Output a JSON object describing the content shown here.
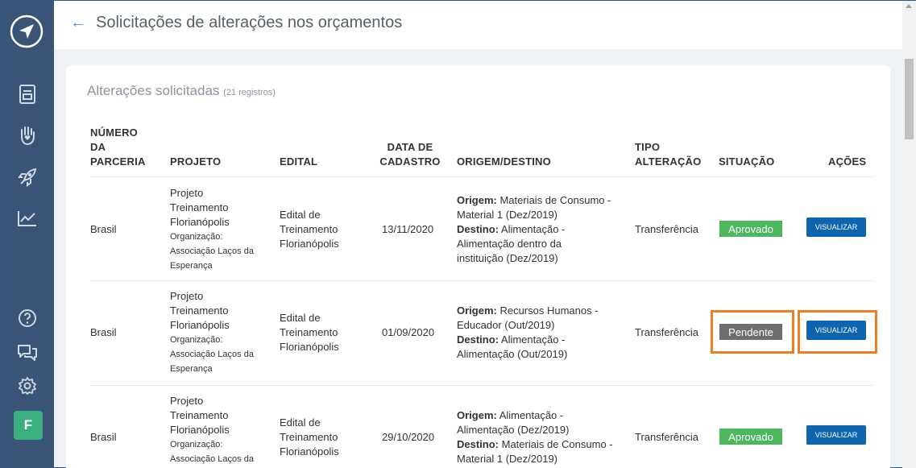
{
  "header": {
    "back_icon": "arrow-left-icon",
    "title": "Solicitações de alterações nos orçamentos"
  },
  "sidebar": {
    "logo_icon": "compass-logo-icon",
    "items": [
      "document-icon",
      "hand-heart-icon",
      "rocket-icon",
      "chart-icon"
    ],
    "bottom": [
      "help-icon",
      "chat-icon",
      "gear-icon"
    ],
    "avatar": "F"
  },
  "section": {
    "title": "Alterações solicitadas",
    "count": "(21 registros)"
  },
  "columns": {
    "numero_1": "NÚMERO",
    "numero_2": "DA",
    "numero_3": "PARCERIA",
    "projeto": "PROJETO",
    "edital": "EDITAL",
    "data_1": "DATA DE",
    "data_2": "CADASTRO",
    "origem": "ORIGEM/DESTINO",
    "tipo_1": "TIPO",
    "tipo_2": "ALTERAÇÃO",
    "situacao": "SITUAÇÃO",
    "acoes": "AÇÕES"
  },
  "rows": [
    {
      "parceria": "Brasil",
      "projeto_1": "Projeto",
      "projeto_2": "Treinamento",
      "projeto_3": "Florianópolis",
      "org_1": "Organização:",
      "org_2": "Associação Laços da",
      "org_3": "Esperança",
      "edital_1": "Edital de",
      "edital_2": "Treinamento",
      "edital_3": "Florianópolis",
      "data": "13/11/2020",
      "origem_label": "Origem:",
      "origem_1": " Materiais de Consumo -",
      "origem_2": "Material 1 (Dez/2019)",
      "destino_label": "Destino:",
      "destino_1": " Alimentação -",
      "destino_2": "Alimentação dentro da",
      "destino_3": "instituição (Dez/2019)",
      "tipo": "Transferência",
      "situacao": "Aprovado",
      "acao": "VISUALIZAR"
    },
    {
      "parceria": "Brasil",
      "projeto_1": "Projeto",
      "projeto_2": "Treinamento",
      "projeto_3": "Florianópolis",
      "org_1": "Organização:",
      "org_2": "Associação Laços da",
      "org_3": "Esperança",
      "edital_1": "Edital de",
      "edital_2": "Treinamento",
      "edital_3": "Florianópolis",
      "data": "01/09/2020",
      "origem_label": "Origem:",
      "origem_1": " Recursos Humanos -",
      "origem_2": "Educador (Out/2019)",
      "destino_label": "Destino:",
      "destino_1": " Alimentação -",
      "destino_2": "Alimentação (Out/2019)",
      "tipo": "Transferência",
      "situacao": "Pendente",
      "acao": "VISUALIZAR"
    },
    {
      "parceria": "Brasil",
      "projeto_1": "Projeto",
      "projeto_2": "Treinamento",
      "projeto_3": "Florianópolis",
      "org_1": "Organização:",
      "org_2": "Associação Laços da",
      "edital_1": "Edital de",
      "edital_2": "Treinamento",
      "edital_3": "Florianópolis",
      "data": "29/10/2020",
      "origem_label": "Origem:",
      "origem_1": " Alimentação -",
      "origem_2": "Alimentação (Dez/2019)",
      "destino_label": "Destino:",
      "destino_1": " Materiais de Consumo -",
      "destino_2": "Material 1 (Dez/2019)",
      "tipo": "Transferência",
      "situacao": "Aprovado",
      "acao": "VISUALIZAR"
    }
  ],
  "colors": {
    "sidebar": "#3a5478",
    "approved": "#4cb75c",
    "pending": "#6e6e6e",
    "button": "#0d65b0",
    "highlight": "#f07d1f"
  }
}
